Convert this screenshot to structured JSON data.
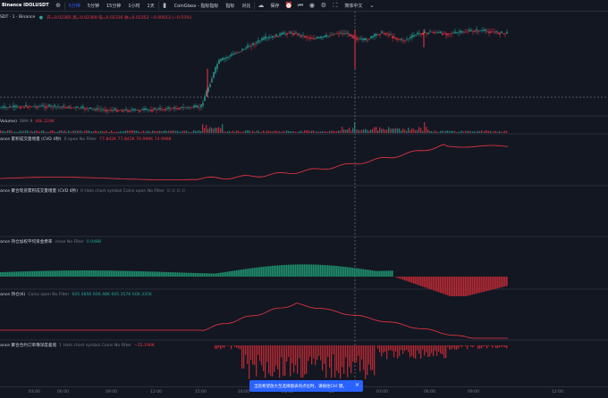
{
  "toolbar": {
    "symbol": "Binance IDOLUSDT",
    "timeframes": [
      "5分钟",
      "5分钟",
      "15分钟",
      "1小时",
      "1天"
    ],
    "selected_timeframe": 0,
    "indicator_menu": "指标",
    "coinglass": "CoinGlass - 指标指标",
    "indicators": "指标",
    "compare": "对比",
    "save": "保存",
    "language": "简体中文",
    "ohlc": "开=0.02365  高=0.02369  低=0.02336  收=0.02352  −0.00013 (−0.55%)"
  },
  "main_pane": {
    "title": "SDT · 1 · Binance"
  },
  "panes": [
    {
      "name": "Volume)",
      "params": "SMA 9",
      "value": "40k.224K",
      "value_color": "red"
    },
    {
      "name": "ance 累积成交量增量 (CVD 4秒)",
      "params": "0 open No Filter",
      "value": "77.842K  77.842K  74.996K  74.996K",
      "value_color": "red"
    },
    {
      "name": "ance 聚合现货累积成交量增量 (CVD 4秒)",
      "params": "0 Hats chart symbol Coins open No Filter",
      "value": "∅ ∅ ∅ ∅",
      "value_color": "grey"
    },
    {
      "name": "ance 持仓加权平均资金费率",
      "params": "close No Filter",
      "value": "0.0488",
      "value_color": "green"
    },
    {
      "name": "ance 持仓(K)",
      "params": "Coins open No Filter",
      "value": "605.485K  606.48K  605.357K  606.335K",
      "value_color": "green"
    },
    {
      "name": "ance 聚合合约订单簿深度差值",
      "params": "1 Hats chart symbol Coins No Filter",
      "value": "−15.196K",
      "value_color": "red"
    }
  ],
  "time_axis": {
    "ticks": [
      "03:00",
      "06:00",
      "09:00",
      "12:00",
      "15:00",
      "18:00",
      "21:00",
      "24",
      "03:00",
      "06:00",
      "09:00",
      "12:00"
    ]
  },
  "toast": {
    "message": "当您希望放大至选择图表的点位时，请按住Ctrl 键。"
  },
  "colors": {
    "background": "#131722",
    "up": "#26a69a",
    "down": "#f23645",
    "accent": "#2962ff",
    "funding_pos": "#1e8c6a",
    "funding_neg": "#b22833"
  },
  "icons": [
    "dollar-icon",
    "indicator-icon",
    "alert-icon",
    "replay-icon",
    "camera-icon",
    "fullscreen-icon",
    "settings-icon"
  ]
}
